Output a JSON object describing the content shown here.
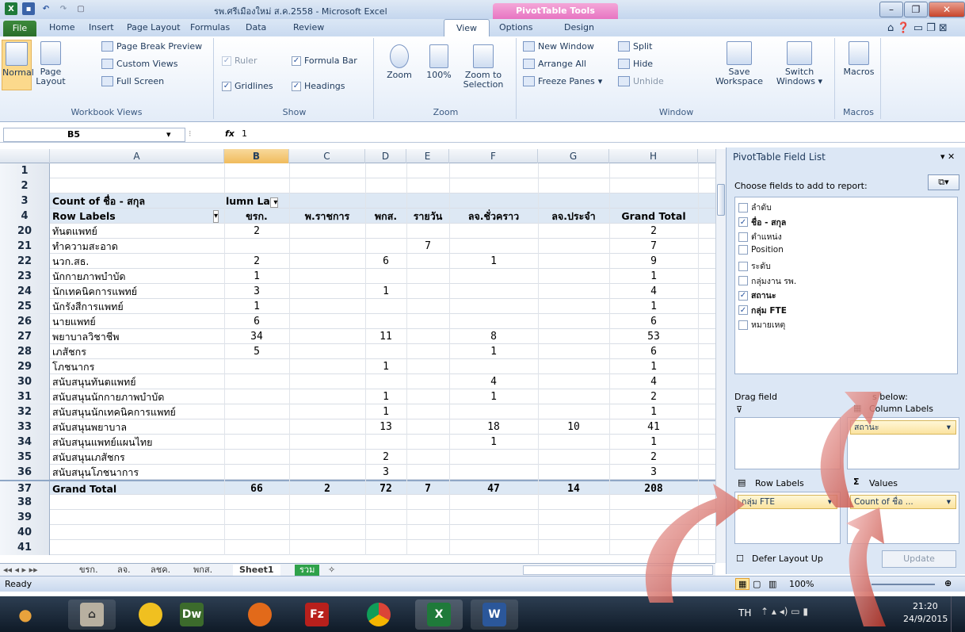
{
  "window": {
    "title": "รพ.ศรีเมืองใหม่ ส.ค.2558 - Microsoft Excel",
    "context_tab": "PivotTable Tools"
  },
  "tabs": [
    "File",
    "Home",
    "Insert",
    "Page Layout",
    "Formulas",
    "Data",
    "Review",
    "View",
    "Options",
    "Design"
  ],
  "ribbon": {
    "workbook_views": {
      "label": "Workbook Views",
      "normal": "Normal",
      "page_layout": "Page Layout",
      "page_break": "Page Break Preview",
      "custom_views": "Custom Views",
      "full_screen": "Full Screen"
    },
    "show": {
      "label": "Show",
      "ruler": "Ruler",
      "formula_bar": "Formula Bar",
      "gridlines": "Gridlines",
      "headings": "Headings"
    },
    "zoom": {
      "label": "Zoom",
      "zoom": "Zoom",
      "hundred": "100%",
      "zoom_sel": "Zoom to Selection"
    },
    "window": {
      "label": "Window",
      "new_window": "New Window",
      "arrange_all": "Arrange All",
      "freeze": "Freeze Panes",
      "split": "Split",
      "hide": "Hide",
      "unhide": "Unhide",
      "save_ws": "Save Workspace",
      "switch": "Switch Windows"
    },
    "macros": {
      "label": "Macros",
      "macros": "Macros"
    }
  },
  "formula": {
    "cell": "B5",
    "fx": "fx",
    "value": "1"
  },
  "columns": [
    "A",
    "B",
    "C",
    "D",
    "E",
    "F",
    "G",
    "H"
  ],
  "pivot": {
    "title_row": {
      "num": "3",
      "label": "Count of ชื่อ - สกุล",
      "col_label": "lumn La"
    },
    "header_row": {
      "num": "4",
      "label": "Row Labels",
      "cols": [
        "ขรก.",
        "พ.ราชการ",
        "พกส.",
        "รายวัน",
        "ลจ.ชั่วคราว",
        "ลจ.ประจำ",
        "Grand Total"
      ]
    },
    "rows": [
      {
        "num": "20",
        "label": "ทันตแพทย์",
        "v": [
          "2",
          "",
          "",
          "",
          "",
          "",
          "2"
        ]
      },
      {
        "num": "21",
        "label": "ทำความสะอาด",
        "v": [
          "",
          "",
          "",
          "7",
          "",
          "",
          "7"
        ]
      },
      {
        "num": "22",
        "label": "นวก.สธ.",
        "v": [
          "2",
          "",
          "6",
          "",
          "1",
          "",
          "9"
        ]
      },
      {
        "num": "23",
        "label": "นักกายภาพบำบัด",
        "v": [
          "1",
          "",
          "",
          "",
          "",
          "",
          "1"
        ]
      },
      {
        "num": "24",
        "label": "นักเทคนิคการแพทย์",
        "v": [
          "3",
          "",
          "1",
          "",
          "",
          "",
          "4"
        ]
      },
      {
        "num": "25",
        "label": "นักรังสีการแพทย์",
        "v": [
          "1",
          "",
          "",
          "",
          "",
          "",
          "1"
        ]
      },
      {
        "num": "26",
        "label": "นายแพทย์",
        "v": [
          "6",
          "",
          "",
          "",
          "",
          "",
          "6"
        ]
      },
      {
        "num": "27",
        "label": "พยาบาลวิชาชีพ",
        "v": [
          "34",
          "",
          "11",
          "",
          "8",
          "",
          "53"
        ]
      },
      {
        "num": "28",
        "label": "เภสัชกร",
        "v": [
          "5",
          "",
          "",
          "",
          "1",
          "",
          "6"
        ]
      },
      {
        "num": "29",
        "label": "โภชนากร",
        "v": [
          "",
          "",
          "1",
          "",
          "",
          "",
          "1"
        ]
      },
      {
        "num": "30",
        "label": "สนับสนุนทันตแพทย์",
        "v": [
          "",
          "",
          "",
          "",
          "4",
          "",
          "4"
        ]
      },
      {
        "num": "31",
        "label": "สนับสนุนนักกายภาพบำบัด",
        "v": [
          "",
          "",
          "1",
          "",
          "1",
          "",
          "2"
        ]
      },
      {
        "num": "32",
        "label": "สนับสนุนนักเทคนิคการแพทย์",
        "v": [
          "",
          "",
          "1",
          "",
          "",
          "",
          "1"
        ]
      },
      {
        "num": "33",
        "label": "สนับสนุนพยาบาล",
        "v": [
          "",
          "",
          "13",
          "",
          "18",
          "10",
          "41"
        ]
      },
      {
        "num": "34",
        "label": "สนับสนุนแพทย์แผนไทย",
        "v": [
          "",
          "",
          "",
          "",
          "1",
          "",
          "1"
        ]
      },
      {
        "num": "35",
        "label": "สนับสนุนเภสัชกร",
        "v": [
          "",
          "",
          "2",
          "",
          "",
          "",
          "2"
        ]
      },
      {
        "num": "36",
        "label": "สนับสนุนโภชนาการ",
        "v": [
          "",
          "",
          "3",
          "",
          "",
          "",
          "3"
        ]
      }
    ],
    "grand_total": {
      "num": "37",
      "label": "Grand Total",
      "v": [
        "66",
        "2",
        "72",
        "7",
        "47",
        "14",
        "208"
      ]
    },
    "empty_rows": [
      "38",
      "39",
      "40",
      "41"
    ],
    "top_rows": [
      "1",
      "2"
    ]
  },
  "sheet_tabs": [
    "ขรก.",
    "ลจ.",
    "ลชค.",
    "พกส.",
    "Sheet1",
    "รวม"
  ],
  "status": {
    "ready": "Ready",
    "zoom": "100%"
  },
  "pane": {
    "title": "PivotTable Field List",
    "choose": "Choose fields to add to report:",
    "fields": [
      {
        "name": "ลำดับ",
        "checked": false
      },
      {
        "name": "ชื่อ - สกุล",
        "checked": true
      },
      {
        "name": "ตำแหน่ง",
        "checked": false
      },
      {
        "name": "Position",
        "checked": false
      },
      {
        "name": "ระดับ",
        "checked": false
      },
      {
        "name": "กลุ่มงาน รพ.",
        "checked": false
      },
      {
        "name": "สถานะ",
        "checked": true
      },
      {
        "name": "กลุ่ม FTE",
        "checked": true
      },
      {
        "name": "หมายเหตุ",
        "checked": false
      }
    ],
    "drag_left": "Drag field",
    "drag_right": "s below:",
    "column_labels": "Column Labels",
    "column_field": "สถานะ",
    "row_labels": "Row Labels",
    "row_field": "กลุ่ม FTE",
    "values": "Values",
    "values_field": "Count of ชื่อ ...",
    "defer": "Defer Layout Up",
    "update": "Update"
  },
  "taskbar": {
    "lang": "TH",
    "time": "21:20",
    "date": "24/9/2015",
    "apps": [
      "apple",
      "library",
      "pacman",
      "Dw",
      "firefox",
      "Fz",
      "chrome",
      "excel",
      "word"
    ]
  }
}
